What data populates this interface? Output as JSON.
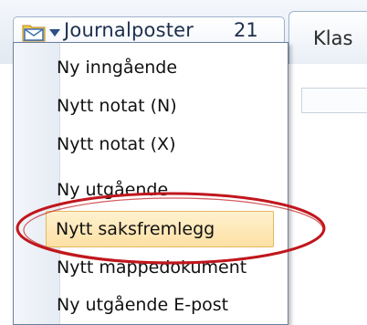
{
  "tabs": {
    "active": {
      "title": "Journalposter",
      "count": "21"
    },
    "next": {
      "label": "Klas"
    }
  },
  "menu": {
    "items": [
      {
        "label": "Ny inngående"
      },
      {
        "label": "Nytt notat (N)"
      },
      {
        "label": "Nytt notat (X)"
      },
      {
        "label": "Ny utgående"
      },
      {
        "label": "Nytt saksfremlegg"
      },
      {
        "label": "Nytt mappedokument"
      },
      {
        "label": "Ny utgående E-post"
      }
    ]
  },
  "colors": {
    "highlight_ring": "#c0171d",
    "hover_fill": "#fde0a4"
  }
}
